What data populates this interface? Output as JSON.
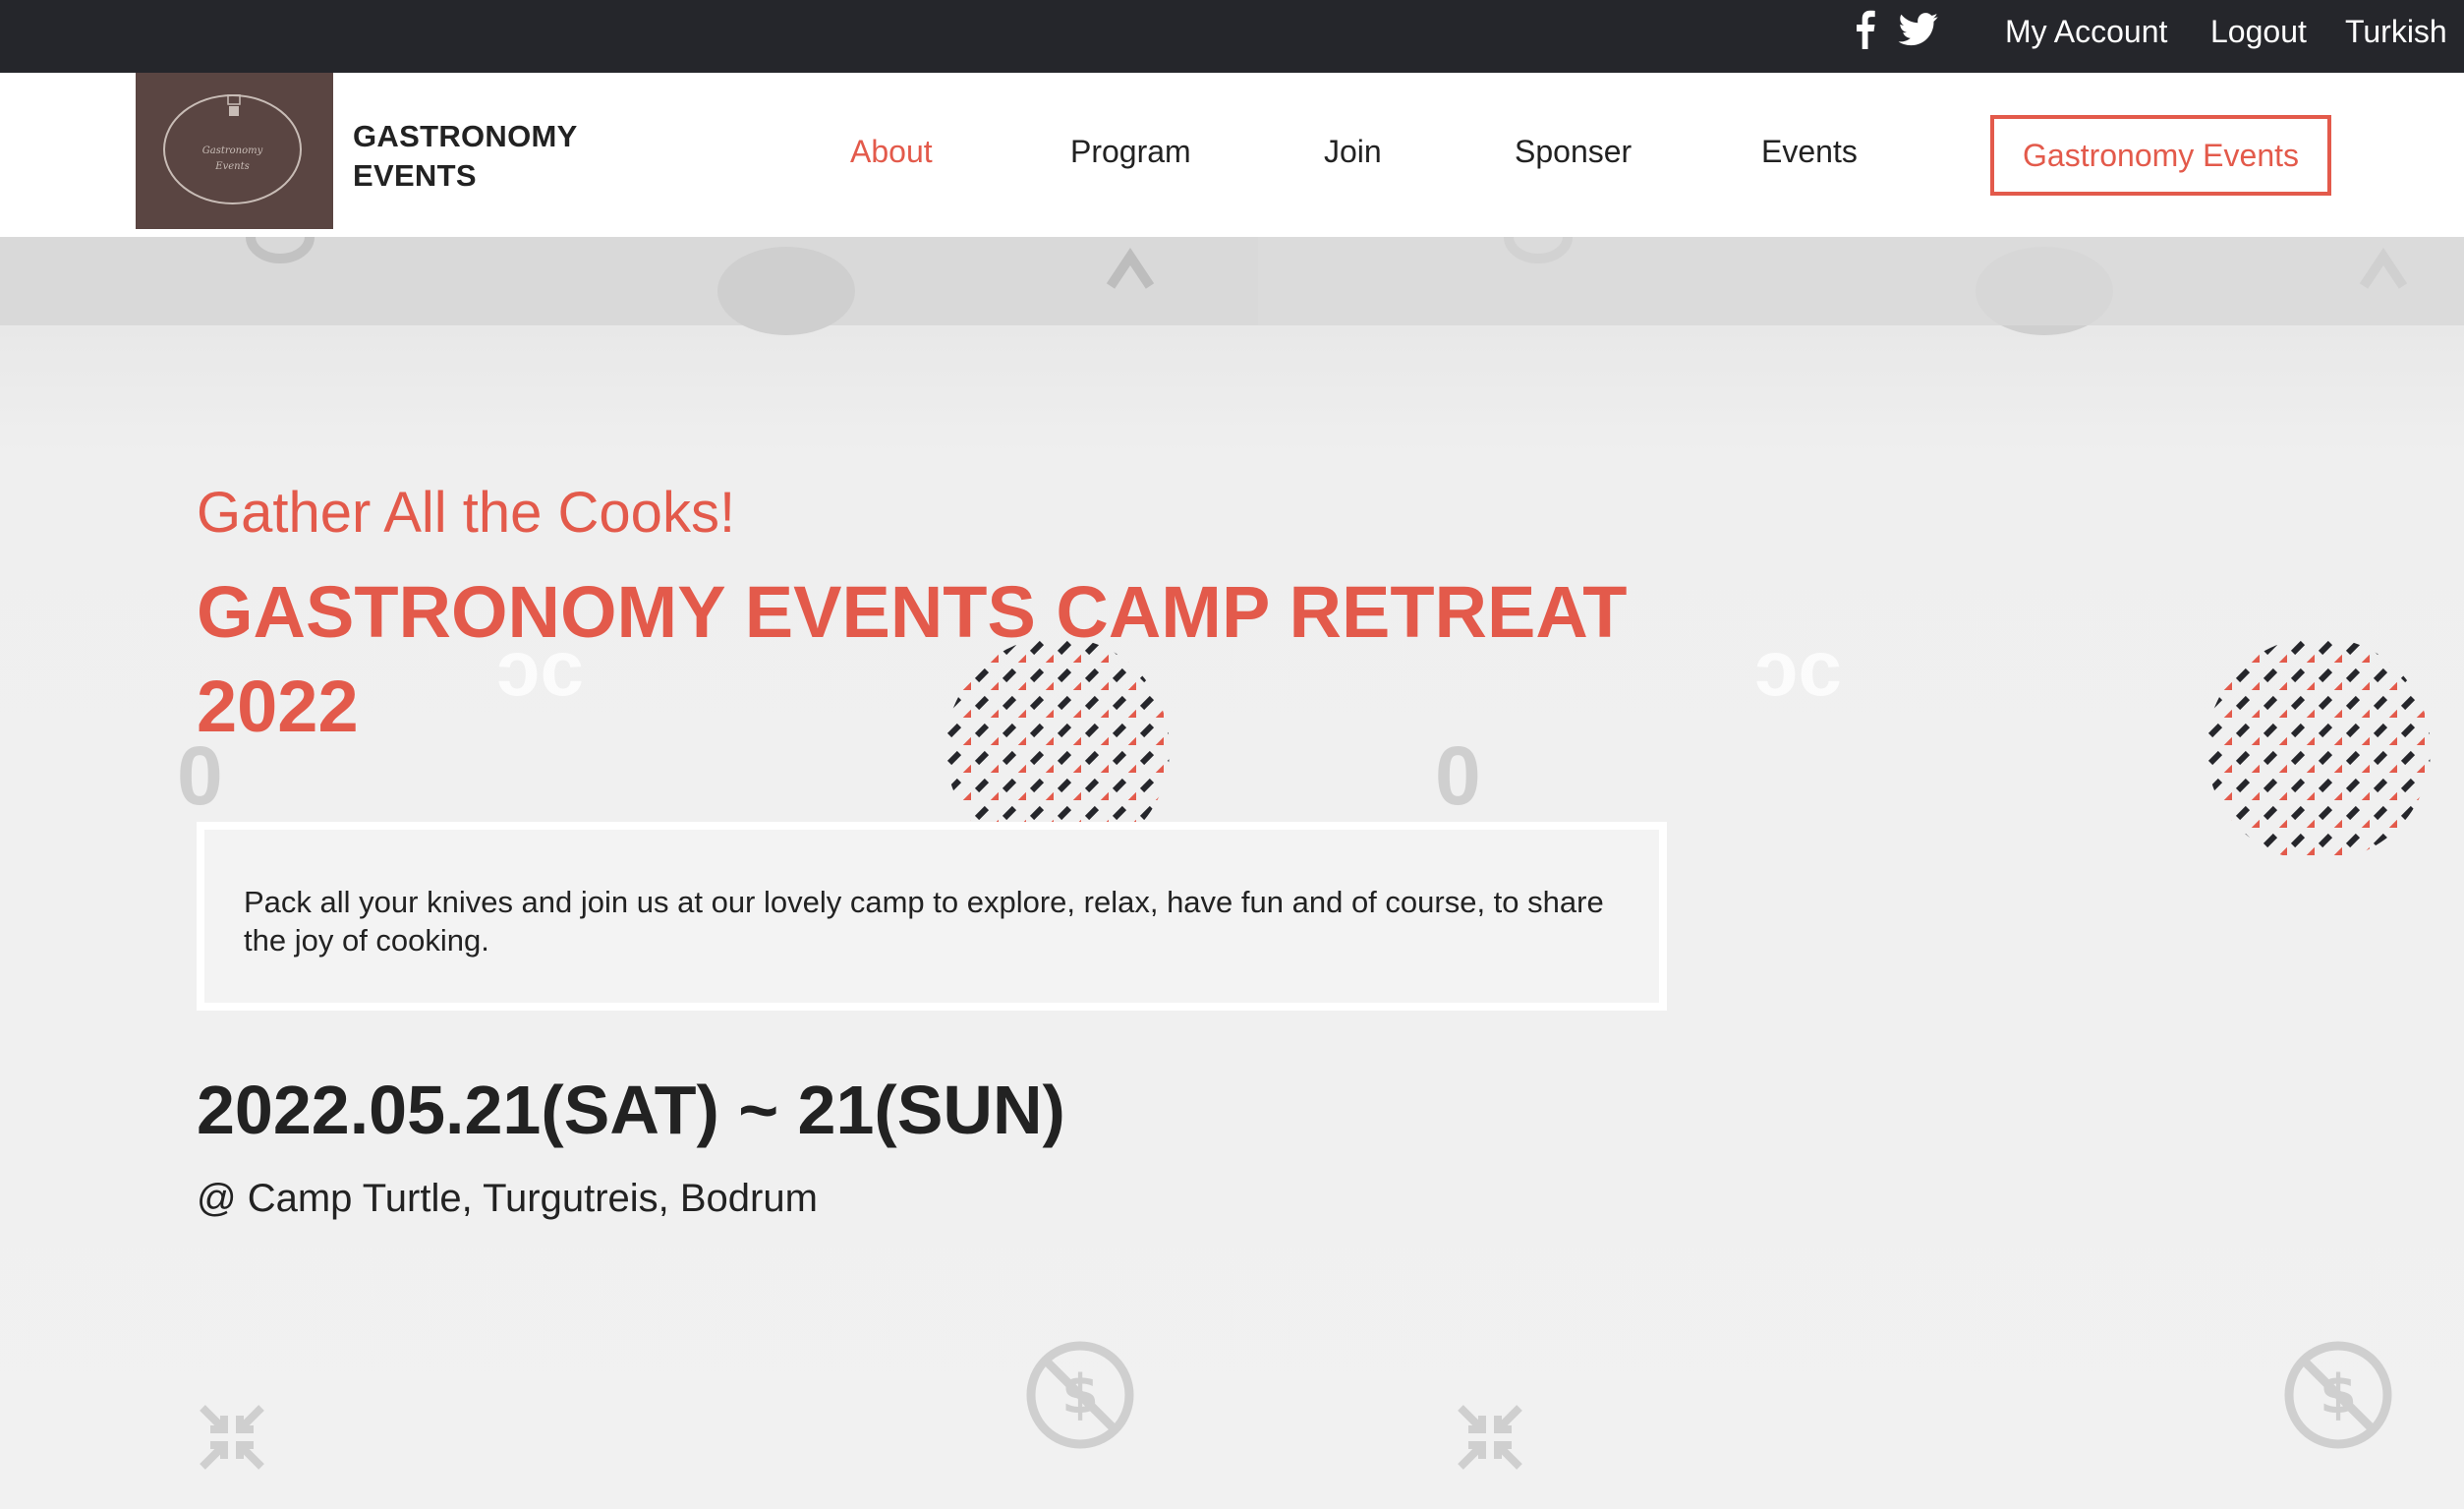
{
  "topbar": {
    "social_icons": [
      "facebook-icon",
      "twitter-icon"
    ],
    "my_account": "My Account",
    "logout": "Logout",
    "language": "Turkish"
  },
  "logo": {
    "line1": "Gastronomy",
    "line2": "Events",
    "bg_color": "#5a4542"
  },
  "brand": {
    "line1": "GASTRONOMY",
    "line2": "EVENTS"
  },
  "nav": {
    "items": [
      {
        "label": "About",
        "active": true
      },
      {
        "label": "Program",
        "active": false
      },
      {
        "label": "Join",
        "active": false
      },
      {
        "label": "Sponser",
        "active": false
      },
      {
        "label": "Events",
        "active": false
      }
    ],
    "cta": "Gastronomy Events"
  },
  "hero": {
    "subtitle": "Gather All the Cooks!",
    "headline_line1": "GASTRONOMY EVENTS CAMP RETREAT",
    "headline_line2": "2022",
    "description": "Pack all your knives and join us at our lovely camp to explore, relax, have fun and of course, to share the joy of cooking.",
    "date": "2022.05.21(SAT) ~ 21(SUN)",
    "venue": "@ Camp Turtle, Turgutreis, Bodrum"
  },
  "colors": {
    "accent": "#e35a4b",
    "dark": "#25262b",
    "text": "#222222"
  }
}
